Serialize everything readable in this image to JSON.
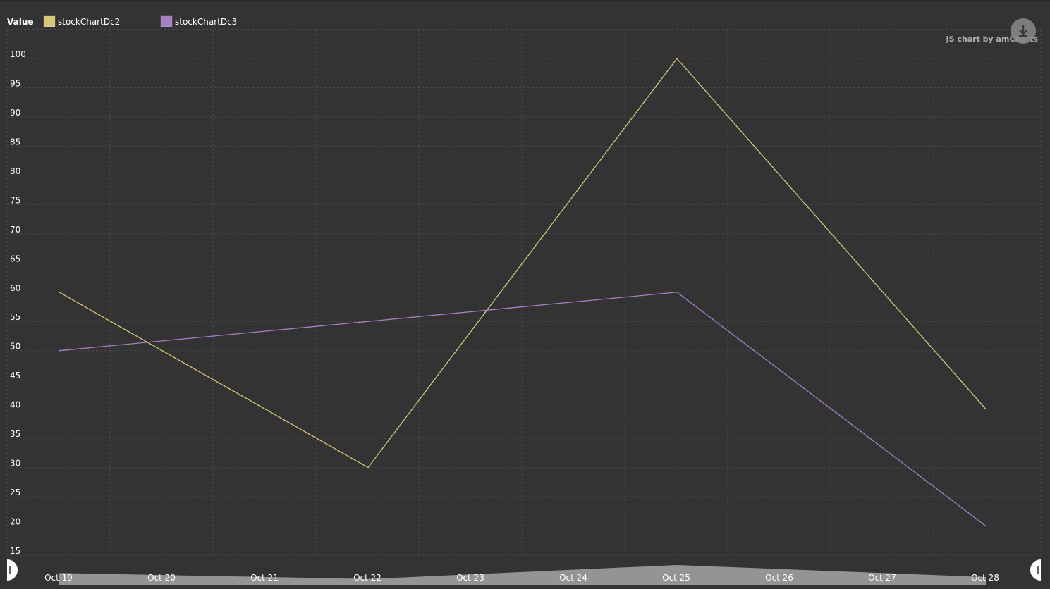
{
  "chart_data": {
    "type": "line",
    "legend": {
      "title": "Value",
      "position": "top-left"
    },
    "categories": [
      "Oct 19",
      "Oct 20",
      "Oct 21",
      "Oct 22",
      "Oct 23",
      "Oct 24",
      "Oct 25",
      "Oct 26",
      "Oct 27",
      "Oct 28"
    ],
    "points_x": [
      "Oct 19",
      "Oct 22",
      "Oct 25",
      "Oct 28"
    ],
    "series": [
      {
        "name": "stockChartDc2",
        "color": "#d8c67a",
        "values": [
          60,
          30,
          100,
          40
        ]
      },
      {
        "name": "stockChartDc3",
        "color": "#a780c6",
        "values": [
          50,
          55,
          60,
          20
        ]
      }
    ],
    "yticks": [
      15,
      20,
      25,
      30,
      35,
      40,
      45,
      50,
      55,
      60,
      65,
      70,
      75,
      80,
      85,
      90,
      95,
      100
    ],
    "ylim": [
      12,
      108
    ],
    "grid": true,
    "scrollbar": true
  },
  "credit": "JS chart by amCharts",
  "export_icon": "download-icon",
  "colors": {
    "background": "#333333",
    "grid": "#4a4a4a",
    "scrollbar": "#9a9a9a"
  }
}
